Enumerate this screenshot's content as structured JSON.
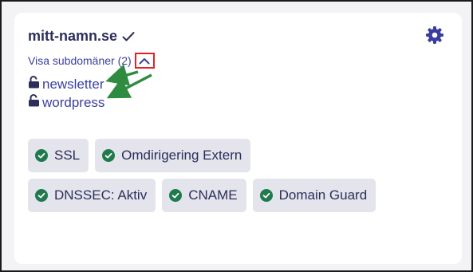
{
  "domain": {
    "name": "mitt-namn.se"
  },
  "subdomains": {
    "toggle_label": "Visa subdomäner (2)",
    "items": [
      {
        "label": "newsletter"
      },
      {
        "label": "wordpress"
      }
    ]
  },
  "badges": [
    {
      "label": "SSL"
    },
    {
      "label": "Omdirigering Extern"
    },
    {
      "label": "DNSSEC: Aktiv"
    },
    {
      "label": "CNAME"
    },
    {
      "label": "Domain Guard"
    }
  ],
  "colors": {
    "accent": "#3a3f9f",
    "title": "#2c2f5b",
    "status_ok": "#1f7a4d",
    "badge_bg": "#e4e4ec",
    "highlight": "#e02424",
    "arrow": "#2e8b3f"
  },
  "icons": {
    "verified": "check-icon",
    "settings": "gear-icon",
    "toggle": "chevron-up-icon",
    "subdomain": "lock-open-icon",
    "badge_status": "check-circle-icon"
  }
}
